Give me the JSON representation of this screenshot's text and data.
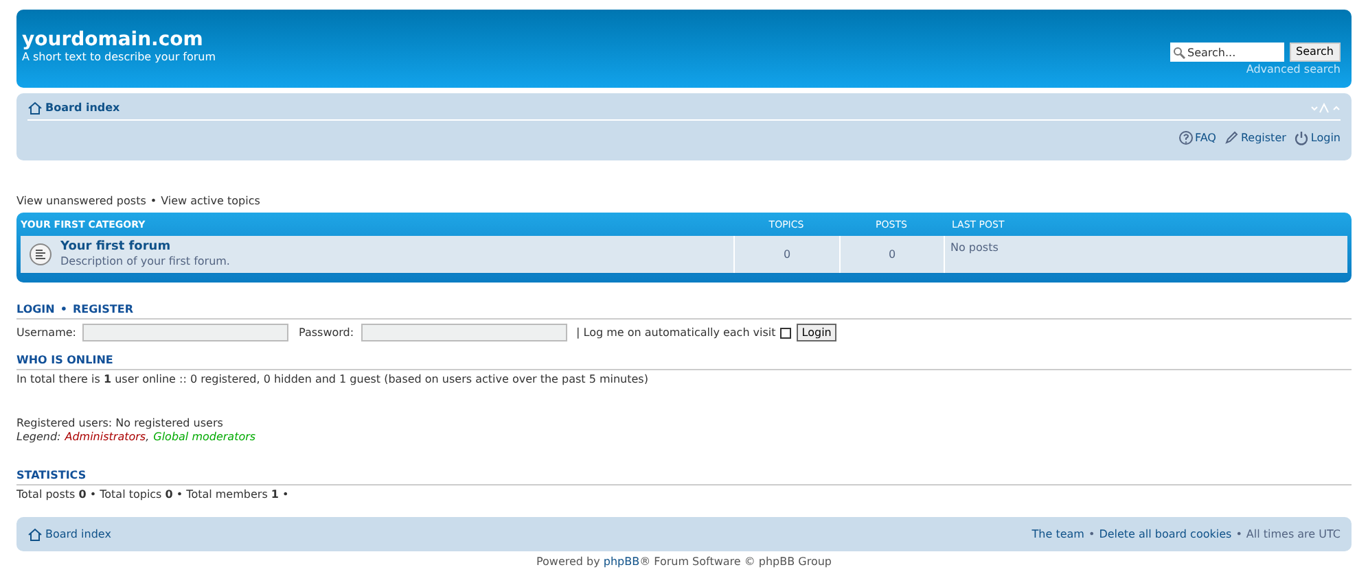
{
  "header": {
    "site_name": "yourdomain.com",
    "description": "A short text to describe your forum",
    "search": {
      "placeholder": "Search...",
      "button": "Search",
      "advanced": "Advanced search"
    }
  },
  "navbar": {
    "breadcrumb": "Board index",
    "links": [
      {
        "label": "FAQ",
        "kind": "faq"
      },
      {
        "label": "Register",
        "kind": "register"
      },
      {
        "label": "Login",
        "kind": "login"
      }
    ]
  },
  "quick_links": {
    "separator": "•",
    "items": [
      "View unanswered posts",
      "View active topics"
    ]
  },
  "category": {
    "title": "YOUR FIRST CATEGORY",
    "columns": [
      "TOPICS",
      "POSTS",
      "LAST POST"
    ],
    "forums": [
      {
        "name": "Your first forum",
        "description": "Description of your first forum.",
        "topics": "0",
        "posts": "0",
        "last_post": "No posts"
      }
    ]
  },
  "login": {
    "heading": [
      "LOGIN",
      "REGISTER"
    ],
    "separator": "•",
    "username_label": "Username:",
    "password_label": "Password:",
    "autologin_label": "| Log me on automatically each visit",
    "autologin_checked": false,
    "button": "Login"
  },
  "who_is_online": {
    "heading": "WHO IS ONLINE",
    "summary": "In total there is **1** user online :: 0 registered, 0 hidden and 1 guest (based on users active over the past 5 minutes)",
    "registered": "Registered users: No registered users",
    "legend_label": "Legend:",
    "group_separator": ",",
    "groups": [
      {
        "label": "Administrators",
        "color": "#aa0000"
      },
      {
        "label": "Global moderators",
        "color": "#00aa00"
      }
    ]
  },
  "statistics": {
    "heading": "STATISTICS",
    "text": "Total posts **0** • Total topics **0** • Total members **1** •"
  },
  "footer": {
    "breadcrumb": "Board index",
    "separator": "•",
    "items": [
      {
        "label": "The team",
        "kind": "link"
      },
      {
        "label": "Delete all board cookies",
        "kind": "link"
      },
      {
        "label": "All times are UTC",
        "kind": "text"
      }
    ]
  },
  "powered_by": {
    "before": "Powered by ",
    "link": "phpBB",
    "after": "® Forum Software © phpBB Group"
  }
}
